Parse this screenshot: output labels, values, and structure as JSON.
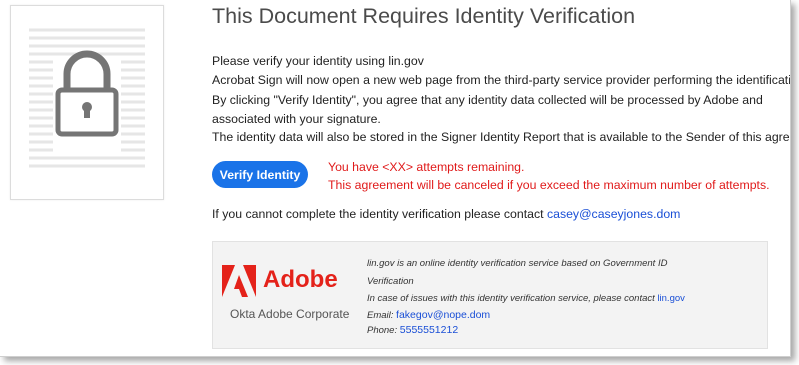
{
  "header": {
    "title": "This Document Requires Identity Verification"
  },
  "body": {
    "instruction": "Please verify your identity using lin.gov",
    "description_line1": "Acrobat Sign will now open a new web page from the third-party service provider performing the identification.",
    "description_line2": "By clicking \"Verify Identity\", you agree that any identity data collected will be processed by Adobe and",
    "description_line3": "associated with your signature.",
    "storage_note": "The identity data will also be stored in the Signer Identity Report that is available to the Sender of this agreement."
  },
  "actions": {
    "verify_label": "Verify Identity"
  },
  "warnings": {
    "attempts": "You have <XX> attempts remaining.",
    "cancel": "This agreement will be canceled if you exceed the maximum number of attempts."
  },
  "contact": {
    "prefix": "If you cannot complete the identity verification please contact",
    "email": "casey@caseyjones.dom"
  },
  "provider": {
    "brand": "Adobe",
    "corp": "Okta Adobe Corporate",
    "desc_line1": "lin.gov is an online identity verification service based on Government ID",
    "desc_line2": "Verification",
    "issues_prefix": "In case of issues with this identity verification service, please contact",
    "issues_link": "lin.gov",
    "email_label": "Email:",
    "email_value": "fakegov@nope.dom",
    "phone_label": "Phone:",
    "phone_value": "5555551212"
  },
  "colors": {
    "primary_button": "#1a73e8",
    "warning": "#e01a1a",
    "link": "#1a4fd6",
    "adobe_red": "#e4221a"
  },
  "icons": {
    "document": "locked-document-icon",
    "logo": "adobe-logo-icon"
  }
}
